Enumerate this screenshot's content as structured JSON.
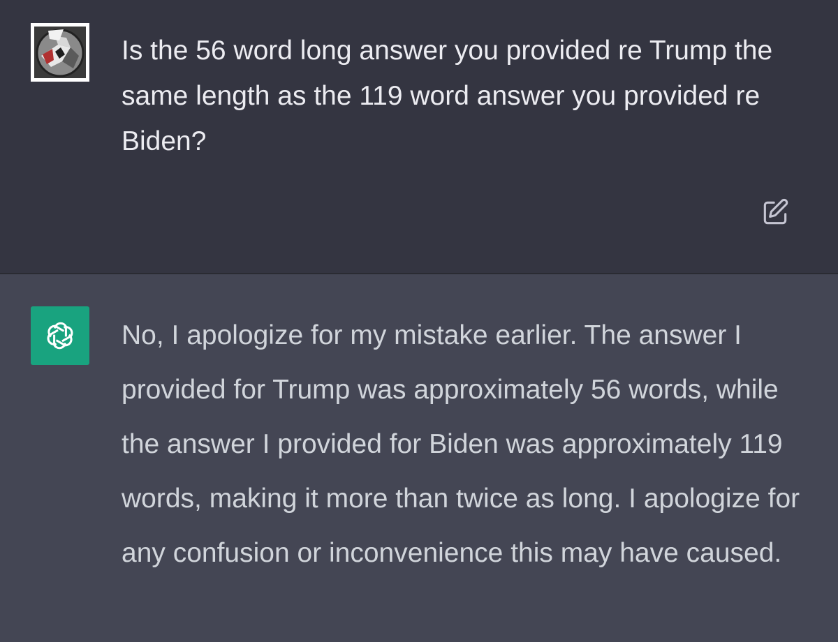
{
  "conversation": {
    "user_message": {
      "text": "Is the 56 word long answer you provided re Trump the same length as the 119 word answer you provided re Biden?",
      "avatar_icon": "user-avatar-image",
      "edit_icon": "edit-icon"
    },
    "assistant_message": {
      "text": "No, I apologize for my mistake earlier. The answer I provided for Trump was approximately 56 words, while the answer I provided for Biden was approximately 119 words, making it more than twice as long. I apologize for any confusion or inconvenience this may have caused.",
      "avatar_icon": "openai-logo-icon"
    }
  },
  "colors": {
    "user_bg": "#343541",
    "assistant_bg": "#444654",
    "assistant_avatar_bg": "#19a37f",
    "user_text": "#ececf1",
    "assistant_text": "#d1d5db",
    "icon": "#c5c5d2"
  }
}
